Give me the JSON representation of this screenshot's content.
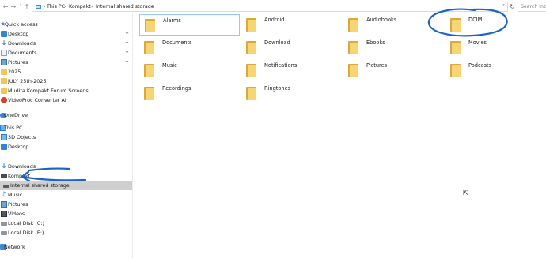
{
  "address_bar": {
    "back_icon": "arrow-left-icon",
    "forward_icon": "arrow-right-icon",
    "recent_icon": "chevron-down-icon",
    "up_icon": "arrow-up-icon",
    "breadcrumbs": [
      "This PC",
      "Kompakt",
      "Internal shared storage"
    ],
    "refresh_icon": "refresh-icon",
    "search_placeholder": "Search Inter"
  },
  "nav_pane": {
    "items": [
      {
        "label": "Quick access",
        "icon": "star-icon"
      },
      {
        "label": "Desktop",
        "icon": "desktop-icon",
        "pinned": true
      },
      {
        "label": "Downloads",
        "icon": "download-icon",
        "pinned": true
      },
      {
        "label": "Documents",
        "icon": "documents-icon",
        "pinned": true
      },
      {
        "label": "Pictures",
        "icon": "pictures-icon",
        "pinned": true
      },
      {
        "label": "2025",
        "icon": "folder-icon"
      },
      {
        "label": "JULY 25th-2025",
        "icon": "folder-icon"
      },
      {
        "label": "Mudita Kompakt Forum Screens",
        "icon": "folder-icon"
      },
      {
        "label": "VideoProc Converter AI",
        "icon": "app-icon"
      },
      {
        "label": "OneDrive",
        "icon": "cloud-icon"
      },
      {
        "label": "This PC",
        "icon": "computer-icon"
      },
      {
        "label": "3D Objects",
        "icon": "cube-icon"
      },
      {
        "label": "Desktop",
        "icon": "desktop-icon"
      },
      {
        "label": "Downloads",
        "icon": "download-icon"
      },
      {
        "label": "Kompakt",
        "icon": "device-icon"
      },
      {
        "label": "Internal shared storage",
        "icon": "storage-icon",
        "selected": true
      },
      {
        "label": "Music",
        "icon": "music-icon"
      },
      {
        "label": "Pictures",
        "icon": "pictures-icon"
      },
      {
        "label": "Videos",
        "icon": "video-icon"
      },
      {
        "label": "Local Disk (C:)",
        "icon": "disk-icon"
      },
      {
        "label": "Local Disk (E:)",
        "icon": "disk-icon"
      },
      {
        "label": "Network",
        "icon": "network-icon"
      }
    ]
  },
  "folders": [
    {
      "label": "Alarms"
    },
    {
      "label": "Android"
    },
    {
      "label": "Audiobooks"
    },
    {
      "label": "DCIM"
    },
    {
      "label": "Documents"
    },
    {
      "label": "Download"
    },
    {
      "label": "Ebooks"
    },
    {
      "label": "Movies"
    },
    {
      "label": "Music"
    },
    {
      "label": "Notifications"
    },
    {
      "label": "Pictures"
    },
    {
      "label": "Podcasts"
    },
    {
      "label": "Recordings"
    },
    {
      "label": "Ringtones"
    }
  ],
  "colors": {
    "selection_bg": "#cfcfcf",
    "focus_border": "#98c9ee",
    "annotation_ink": "#1a63c7",
    "folder_back": "#dca83c",
    "folder_front": "#f6d575"
  }
}
